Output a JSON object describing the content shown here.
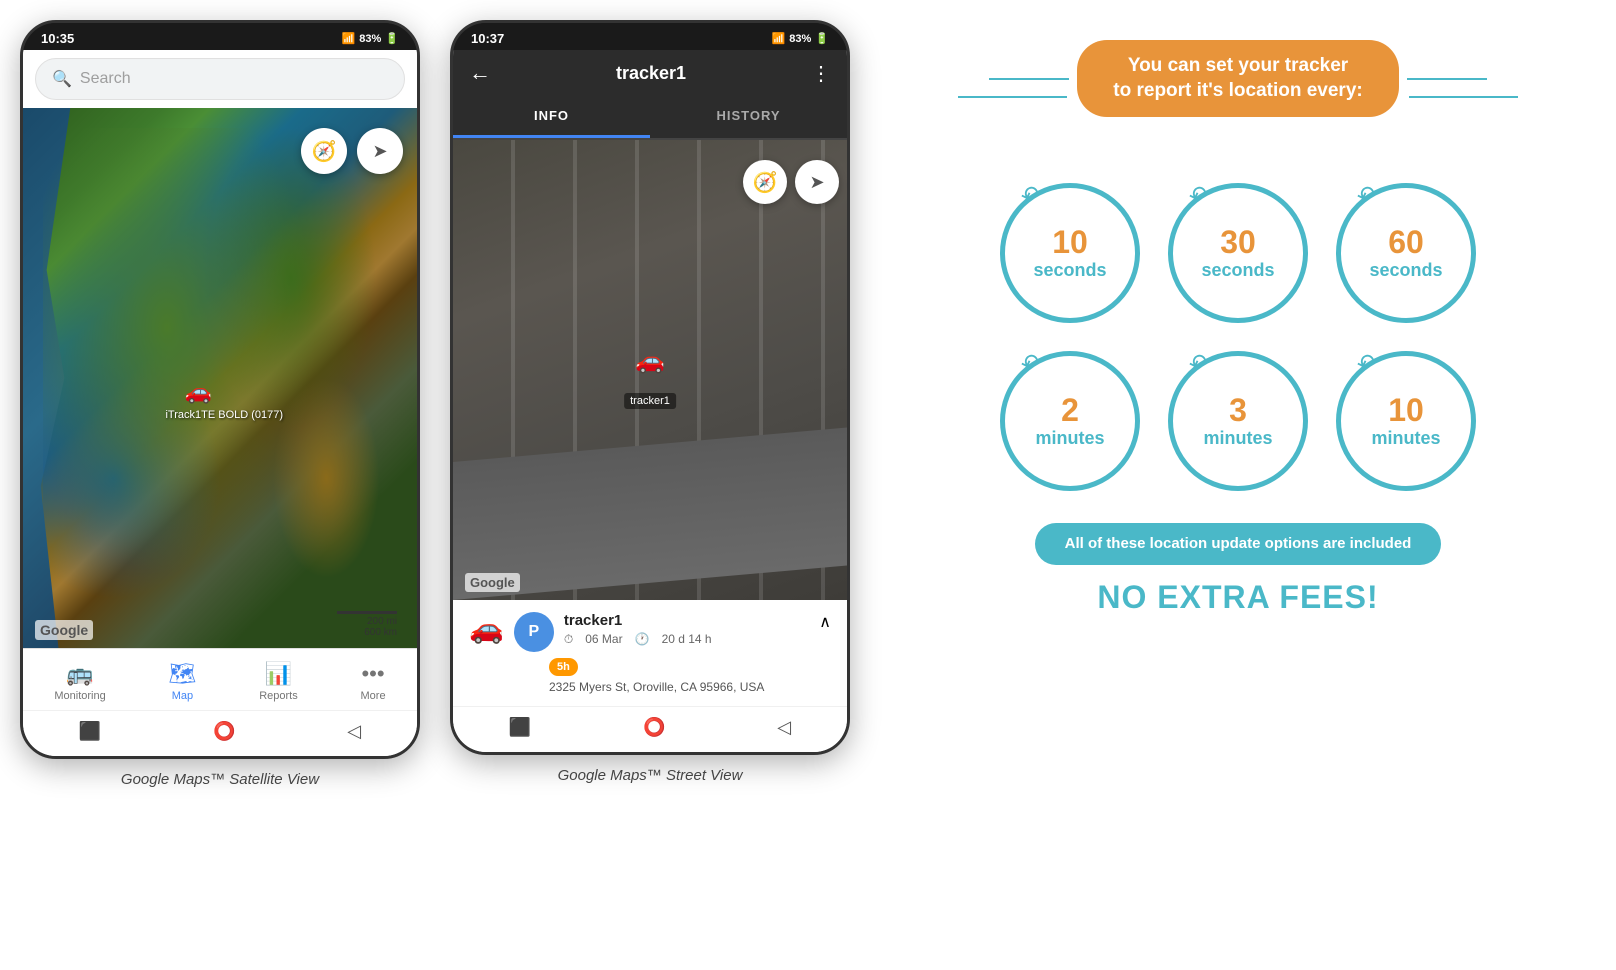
{
  "page": {
    "background": "#ffffff"
  },
  "phone1": {
    "status_bar": {
      "time": "10:35",
      "signal": "📶",
      "wifi": "WiFi",
      "battery": "83%"
    },
    "search": {
      "placeholder": "Search"
    },
    "map": {
      "type": "satellite",
      "compass_icon": "🧭",
      "location_icon": "➤",
      "google_label": "Google",
      "scale_200mi": "200 mi",
      "scale_600km": "600 km",
      "tracker_label": "iTrack1TE BOLD (0177)"
    },
    "nav_items": [
      {
        "icon": "🚌",
        "label": "Monitoring",
        "active": false
      },
      {
        "icon": "🗺",
        "label": "Map",
        "active": true
      },
      {
        "icon": "📊",
        "label": "Reports",
        "active": false
      },
      {
        "icon": "•••",
        "label": "More",
        "active": false
      }
    ],
    "caption": "Google Maps™ Satellite View"
  },
  "phone2": {
    "status_bar": {
      "time": "10:37",
      "battery": "83%"
    },
    "header": {
      "back_icon": "←",
      "title": "tracker1",
      "menu_icon": "⋮"
    },
    "tabs": [
      {
        "label": "INFO",
        "active": true
      },
      {
        "label": "HISTORY",
        "active": false
      }
    ],
    "map": {
      "type": "street",
      "compass_icon": "🧭",
      "location_icon": "➤",
      "google_label": "Google",
      "tracker_label": "tracker1"
    },
    "tracker_info": {
      "icon": "🚗",
      "avatar_letter": "P",
      "name": "tracker1",
      "date": "06 Mar",
      "duration": "20 d 14 h",
      "address": "2325 Myers St, Oroville, CA 95966, USA",
      "badge": "5h"
    },
    "caption": "Google Maps™ Street View"
  },
  "infographic": {
    "header_line": true,
    "header_text": "You can set your tracker\nto report it's location every:",
    "time_options": [
      {
        "number": "10",
        "unit": "seconds"
      },
      {
        "number": "30",
        "unit": "seconds"
      },
      {
        "number": "60",
        "unit": "seconds"
      },
      {
        "number": "2",
        "unit": "minutes"
      },
      {
        "number": "3",
        "unit": "minutes"
      },
      {
        "number": "10",
        "unit": "minutes"
      }
    ],
    "banner_text": "All of these location update options are included",
    "no_fees_text": "NO EXTRA FEES!"
  }
}
